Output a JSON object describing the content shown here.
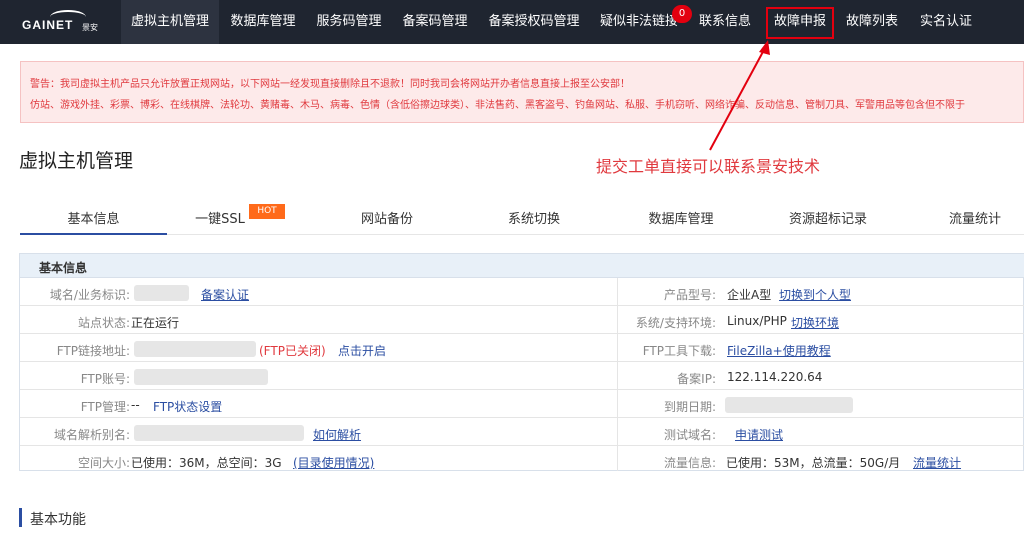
{
  "logo": {
    "brand": "GAINET",
    "sub": "景安"
  },
  "nav": {
    "items": [
      {
        "label": "虚拟主机管理"
      },
      {
        "label": "数据库管理"
      },
      {
        "label": "服务码管理"
      },
      {
        "label": "备案码管理"
      },
      {
        "label": "备案授权码管理"
      },
      {
        "label": "疑似非法链接",
        "badge": "0"
      },
      {
        "label": "联系信息"
      },
      {
        "label": "故障申报"
      },
      {
        "label": "故障列表"
      },
      {
        "label": "实名认证"
      }
    ]
  },
  "warning": {
    "line1": "警告：我司虚拟主机产品只允许放置正规网站，以下网站一经发现直接删除且不退款！同时我司会将网站开办者信息直接上报至公安部！",
    "line2": "仿站、游戏外挂、彩票、博彩、在线棋牌、法轮功、黄赌毒、木马、病毒、色情（含低俗擦边球类）、非法售药、黑客盗号、钓鱼网站、私服、手机窃听、网络诈骗、反动信息、管制刀具、军警用品等包含但不限于"
  },
  "page": {
    "title": "虚拟主机管理"
  },
  "annotation": {
    "text": "提交工单直接可以联系景安技术"
  },
  "tabs": {
    "items": [
      {
        "label": "基本信息"
      },
      {
        "label": "一键SSL"
      },
      {
        "label": "网站备份"
      },
      {
        "label": "系统切换"
      },
      {
        "label": "数据库管理"
      },
      {
        "label": "资源超标记录"
      },
      {
        "label": "流量统计"
      }
    ],
    "hot_badge": "HOT"
  },
  "info": {
    "header": "基本信息",
    "domain_label": "域名/业务标识:",
    "domain_link": "备案认证",
    "model_label": "产品型号:",
    "model_value": "企业A型",
    "model_link": "切换到个人型",
    "status_label": "站点状态:",
    "status_value": "正在运行",
    "system_label": "系统/支持环境:",
    "system_value": "Linux/PHP",
    "system_link": "切换环境",
    "ftp_addr_label": "FTP链接地址:",
    "ftp_closed": "(FTP已关闭)",
    "ftp_open_link": "点击开启",
    "ftp_tool_label": "FTP工具下载:",
    "ftp_tool_link": "FileZilla+使用教程",
    "ftp_account_label": "FTP账号:",
    "ip_label": "备案IP:",
    "ip_value": "122.114.220.64",
    "ftp_manage_label": "FTP管理:",
    "ftp_manage_value": "--",
    "ftp_manage_link": "FTP状态设置",
    "expire_label": "到期日期:",
    "alias_label": "域名解析别名:",
    "alias_link": "如何解析",
    "test_label": "测试域名:",
    "test_link": "申请测试",
    "space_label": "空间大小:",
    "space_value": "已使用：36M，总空间：3G",
    "space_link": "(目录使用情况)",
    "traffic_label": "流量信息:",
    "traffic_value": "已使用：53M，总流量：50G/月",
    "traffic_link": "流量统计"
  },
  "section": {
    "title": "基本功能"
  }
}
